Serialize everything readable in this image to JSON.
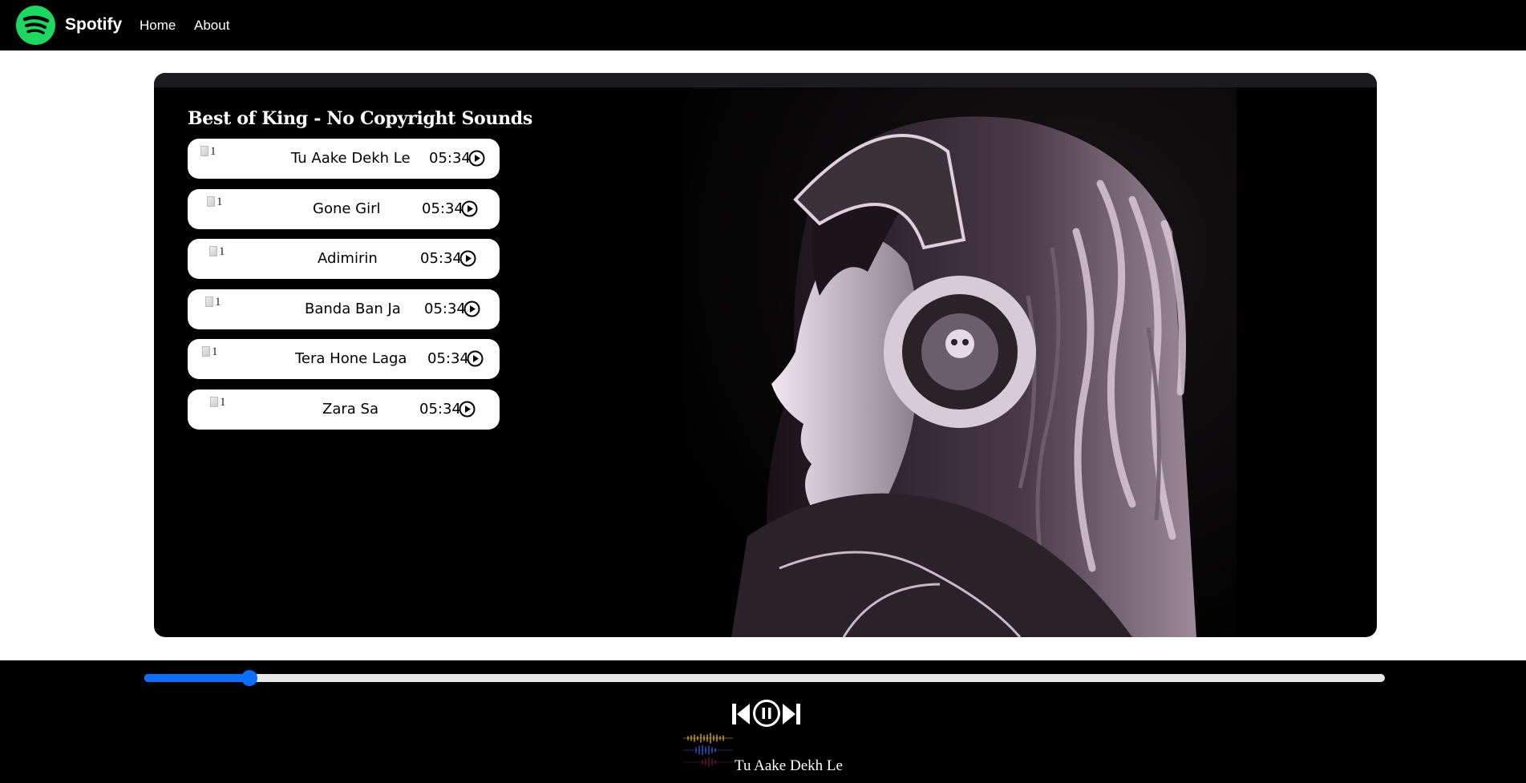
{
  "navbar": {
    "brand": "Spotify",
    "links": [
      "Home",
      "About"
    ],
    "logo_color": "#1ed760"
  },
  "playlist": {
    "title": "Best of King - No Copyright Sounds",
    "songs": [
      {
        "name": "Tu Aake Dekh Le",
        "duration": "05:34",
        "img_alt": "1"
      },
      {
        "name": "Gone Girl",
        "duration": "05:34",
        "img_alt": "1"
      },
      {
        "name": "Adimirin",
        "duration": "05:34",
        "img_alt": "1"
      },
      {
        "name": "Banda Ban Ja",
        "duration": "05:34",
        "img_alt": "1"
      },
      {
        "name": "Tera Hone Laga",
        "duration": "05:34",
        "img_alt": "1"
      },
      {
        "name": "Zara Sa",
        "duration": "05:34",
        "img_alt": "1"
      }
    ]
  },
  "player": {
    "progress_fraction": 0.085,
    "accent_color": "#0d6efd",
    "now_playing": "Tu Aake Dekh Le",
    "controls": [
      "previous-icon",
      "pause-icon",
      "next-icon"
    ]
  },
  "hero": {
    "icon": "headphones-portrait-image"
  }
}
